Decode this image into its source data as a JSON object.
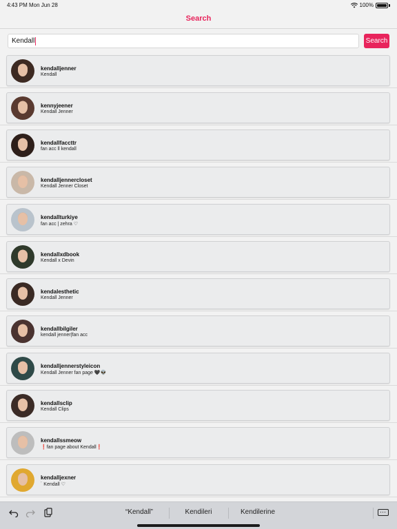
{
  "status_bar": {
    "time": "4:43 PM",
    "date": "Mon Jun 28",
    "battery": "100%",
    "wifi_icon": "wifi-icon",
    "battery_icon": "battery-icon"
  },
  "header": {
    "title": "Search"
  },
  "search": {
    "query": "Kendall",
    "button_label": "Search"
  },
  "colors": {
    "accent": "#e8245c",
    "card_bg": "#ebeced"
  },
  "results": [
    {
      "username": "kendalljenner",
      "name": "Kendall",
      "avatar_color": "#3d2a22"
    },
    {
      "username": "kennyjeener",
      "name": "Kendall Jenner",
      "avatar_color": "#5a3a30"
    },
    {
      "username": "kendallfaccttr",
      "name": "fan acc ll kendall",
      "avatar_color": "#2e1f1a"
    },
    {
      "username": "kendalljennercloset",
      "name": "Kendall Jenner Closet",
      "avatar_color": "#c9b8a8"
    },
    {
      "username": "kendallturkiye",
      "name": "fan acc | zehra ♡",
      "avatar_color": "#b9c3cc"
    },
    {
      "username": "kendallxdbook",
      "name": "Kendall x Devin",
      "avatar_color": "#2f3a2b"
    },
    {
      "username": "kendalesthetic",
      "name": "Kendall Jenner",
      "avatar_color": "#3a2a24"
    },
    {
      "username": "kendallbilgiler",
      "name": "kendall jenner|fan acc",
      "avatar_color": "#4a3330"
    },
    {
      "username": "kendalljennerstyleicon",
      "name": "Kendall Jenner fan page 🖤👽",
      "avatar_color": "#2f4a48"
    },
    {
      "username": "kendallsclip",
      "name": "Kendall Clips",
      "avatar_color": "#3b2b26"
    },
    {
      "username": "kendallssmeow",
      "name": "❗️fan page about Kendall❗️",
      "avatar_color": "#bdbdbd"
    },
    {
      "username": "kendalljexner",
      "name": "˙ Kendall ♡",
      "avatar_color": "#e0a830"
    }
  ],
  "keyboard_bar": {
    "undo_icon": "undo-icon",
    "redo_icon": "redo-icon",
    "paste_icon": "paste-icon",
    "suggestions": [
      "“Kendall”",
      "Kendileri",
      "Kendilerine"
    ],
    "keyboard_icon": "keyboard-icon"
  }
}
